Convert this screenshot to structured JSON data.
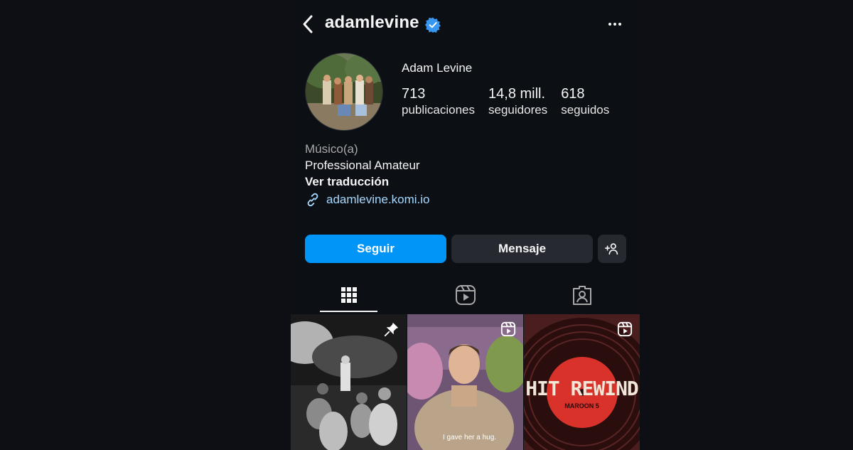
{
  "profile": {
    "username": "adamlevine",
    "full_name": "Adam Levine",
    "verified": true,
    "category": "Músico(a)",
    "bio": "Professional Amateur",
    "translate_label": "Ver traducción",
    "link": "adamlevine.komi.io"
  },
  "stats": [
    {
      "value": "713",
      "label": "publicaciones"
    },
    {
      "value": "14,8 mill.",
      "label": "seguidores"
    },
    {
      "value": "618",
      "label": "seguidos"
    }
  ],
  "actions": {
    "follow_label": "Seguir",
    "message_label": "Mensaje",
    "add_user_icon": "add-person-icon"
  },
  "tabs": [
    {
      "name": "posts",
      "icon": "grid-icon",
      "active": true
    },
    {
      "name": "reels",
      "icon": "reels-icon",
      "active": false
    },
    {
      "name": "tagged",
      "icon": "tagged-icon",
      "active": false
    }
  ],
  "posts": [
    {
      "type": "pinned",
      "icon": "pin-icon"
    },
    {
      "type": "reel",
      "icon": "reel-icon",
      "caption": "I gave her a hug."
    },
    {
      "type": "reel",
      "icon": "reel-icon",
      "title": "HIT REWIND",
      "subtitle": "MAROON 5"
    }
  ],
  "colors": {
    "background": "#0c1014",
    "accent": "#0095f6",
    "secondary_button": "#262a30",
    "link": "#a7d8ff",
    "verified_badge": "#3897f0"
  }
}
